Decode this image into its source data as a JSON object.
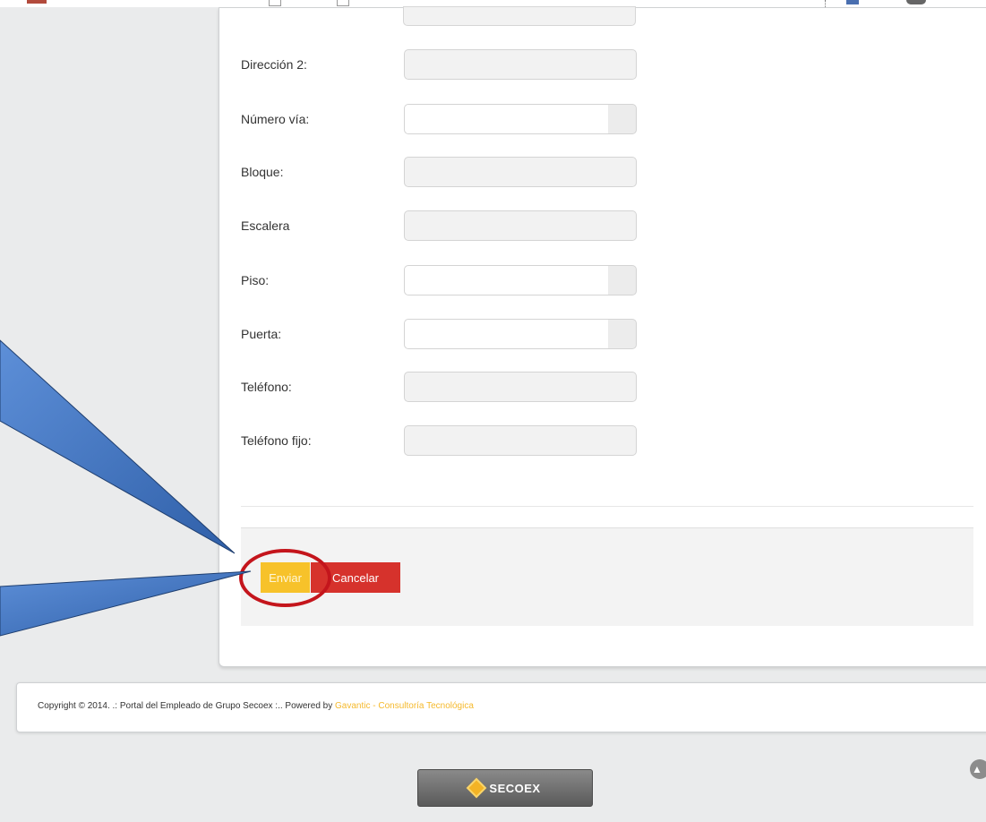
{
  "form": {
    "fields": [
      {
        "label": "Dirección 2:",
        "value": ""
      },
      {
        "label": "Número vía:",
        "value": ""
      },
      {
        "label": "Bloque:",
        "value": ""
      },
      {
        "label": "Escalera",
        "value": ""
      },
      {
        "label": "Piso:",
        "value": ""
      },
      {
        "label": "Puerta:",
        "value": ""
      },
      {
        "label": "Teléfono:",
        "value": ""
      },
      {
        "label": "Teléfono fijo:",
        "value": ""
      }
    ],
    "send_label": "Enviar",
    "cancel_label": "Cancelar"
  },
  "footer": {
    "copyright": "Copyright © 2014. .: Portal del Empleado de Grupo Secoex :.. Powered by ",
    "link_text": "Gavantic - Consultoría Tecnológica"
  },
  "logo": {
    "text": "SECOEX"
  },
  "colors": {
    "send_button": "#f7c22a",
    "cancel_button": "#d6322c",
    "highlight_ring": "#c4151c",
    "callout_arrow": "#3f74c4",
    "footer_link": "#f5b92c"
  },
  "icons": {
    "scroll_top": "chevron-up-icon",
    "logo_mark": "diamond-logo-icon"
  }
}
